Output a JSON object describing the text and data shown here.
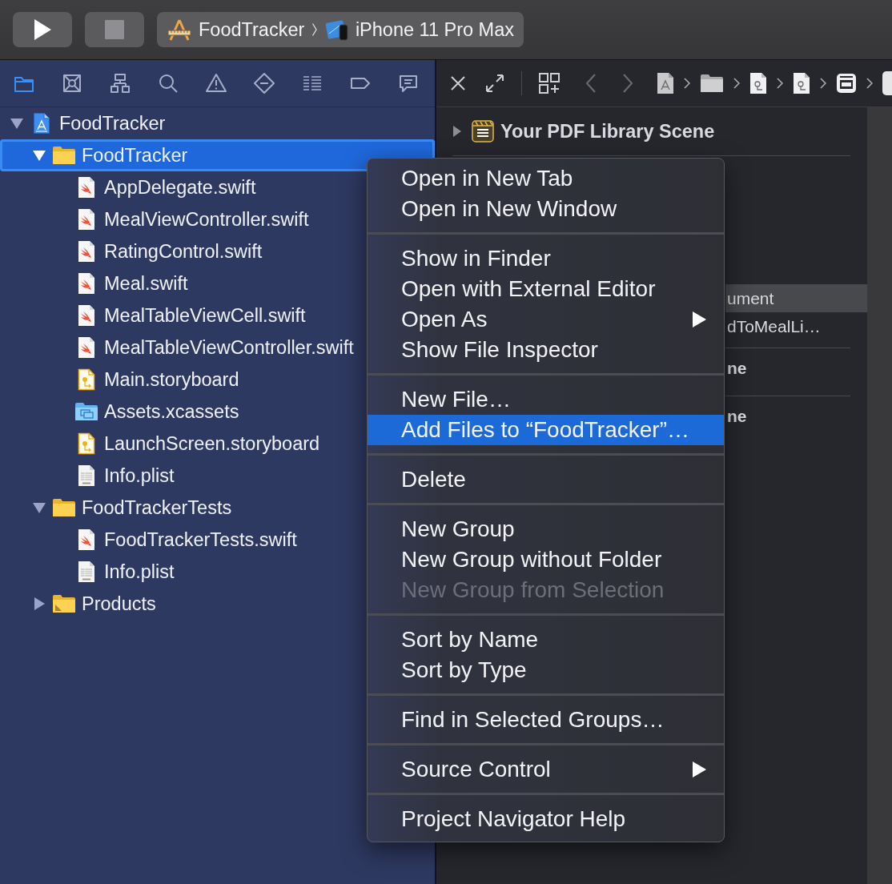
{
  "toolbar": {
    "scheme": "FoodTracker",
    "destination": "iPhone 11 Pro Max"
  },
  "navigator": {
    "tabs": [
      {
        "kind": "project",
        "selected": true
      },
      {
        "kind": "source_control",
        "selected": false
      },
      {
        "kind": "symbol",
        "selected": false
      },
      {
        "kind": "find",
        "selected": false
      },
      {
        "kind": "issue",
        "selected": false
      },
      {
        "kind": "test",
        "selected": false
      },
      {
        "kind": "debug",
        "selected": false
      },
      {
        "kind": "breakpoint",
        "selected": false
      },
      {
        "kind": "report",
        "selected": false
      }
    ]
  },
  "tree": [
    {
      "label": "FoodTracker",
      "kind": "project",
      "expanded": true,
      "selected": false,
      "children": [
        {
          "label": "FoodTracker",
          "kind": "folder",
          "expanded": true,
          "selected": true,
          "children": [
            {
              "label": "AppDelegate.swift",
              "kind": "swift",
              "selected": false
            },
            {
              "label": "MealViewController.swift",
              "kind": "swift",
              "selected": false
            },
            {
              "label": "RatingControl.swift",
              "kind": "swift",
              "selected": false
            },
            {
              "label": "Meal.swift",
              "kind": "swift",
              "selected": false
            },
            {
              "label": "MealTableViewCell.swift",
              "kind": "swift",
              "selected": false
            },
            {
              "label": "MealTableViewController.swift",
              "kind": "swift",
              "selected": false
            },
            {
              "label": "Main.storyboard",
              "kind": "storyboard",
              "selected": false
            },
            {
              "label": "Assets.xcassets",
              "kind": "assets",
              "selected": false
            },
            {
              "label": "LaunchScreen.storyboard",
              "kind": "storyboard",
              "selected": false
            },
            {
              "label": "Info.plist",
              "kind": "plist",
              "selected": false
            }
          ]
        },
        {
          "label": "FoodTrackerTests",
          "kind": "folder",
          "expanded": true,
          "selected": false,
          "children": [
            {
              "label": "FoodTrackerTests.swift",
              "kind": "swift",
              "selected": false
            },
            {
              "label": "Info.plist",
              "kind": "plist",
              "selected": false
            }
          ]
        },
        {
          "label": "Products",
          "kind": "products",
          "expanded": false,
          "selected": false
        }
      ]
    }
  ],
  "editor": {
    "scene": {
      "title": "Your PDF Library Scene",
      "expanded": false
    },
    "rows": [
      {
        "label": "ument",
        "kind": "item",
        "selected": true
      },
      {
        "label": "dToMealLi…",
        "kind": "item",
        "selected": false
      },
      {
        "label": "ne",
        "kind": "heading",
        "selected": false
      },
      {
        "label": "ne",
        "kind": "heading",
        "selected": false
      }
    ]
  },
  "context_menu": {
    "groups": [
      {
        "items": [
          {
            "label": "Open in New Tab",
            "selected": false,
            "disabled": false,
            "submenu": false
          },
          {
            "label": "Open in New Window",
            "selected": false,
            "disabled": false,
            "submenu": false
          }
        ]
      },
      {
        "items": [
          {
            "label": "Show in Finder",
            "selected": false,
            "disabled": false,
            "submenu": false
          },
          {
            "label": "Open with External Editor",
            "selected": false,
            "disabled": false,
            "submenu": false
          },
          {
            "label": "Open As",
            "selected": false,
            "disabled": false,
            "submenu": true
          },
          {
            "label": "Show File Inspector",
            "selected": false,
            "disabled": false,
            "submenu": false
          }
        ]
      },
      {
        "items": [
          {
            "label": "New File…",
            "selected": false,
            "disabled": false,
            "submenu": false
          },
          {
            "label": "Add Files to “FoodTracker”…",
            "selected": true,
            "disabled": false,
            "submenu": false
          }
        ]
      },
      {
        "items": [
          {
            "label": "Delete",
            "selected": false,
            "disabled": false,
            "submenu": false
          }
        ]
      },
      {
        "items": [
          {
            "label": "New Group",
            "selected": false,
            "disabled": false,
            "submenu": false
          },
          {
            "label": "New Group without Folder",
            "selected": false,
            "disabled": false,
            "submenu": false
          },
          {
            "label": "New Group from Selection",
            "selected": false,
            "disabled": true,
            "submenu": false
          }
        ]
      },
      {
        "items": [
          {
            "label": "Sort by Name",
            "selected": false,
            "disabled": false,
            "submenu": false
          },
          {
            "label": "Sort by Type",
            "selected": false,
            "disabled": false,
            "submenu": false
          }
        ]
      },
      {
        "items": [
          {
            "label": "Find in Selected Groups…",
            "selected": false,
            "disabled": false,
            "submenu": false
          }
        ]
      },
      {
        "items": [
          {
            "label": "Source Control",
            "selected": false,
            "disabled": false,
            "submenu": true
          }
        ]
      },
      {
        "items": [
          {
            "label": "Project Navigator Help",
            "selected": false,
            "disabled": false,
            "submenu": false
          }
        ]
      }
    ]
  }
}
